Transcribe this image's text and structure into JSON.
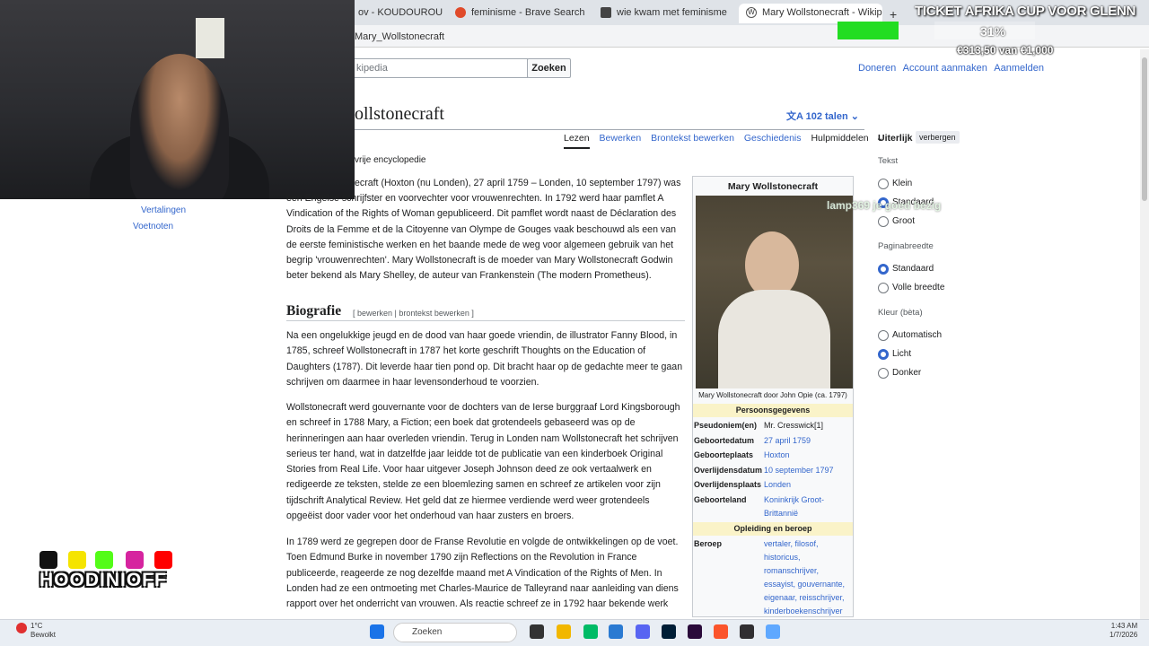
{
  "browser": {
    "tabs": [
      {
        "label": "ov - KOUDOUROU X BOH"
      },
      {
        "label": "feminisme - Brave Search"
      },
      {
        "label": "wie kwam met feminisme"
      },
      {
        "label": "Mary Wollstonecraft - Wikipedia"
      }
    ],
    "new_tab": "+",
    "url": "Mary_Wollstonecraft"
  },
  "wiki": {
    "search_placeholder": "kipedia",
    "search_button": "Zoeken",
    "top_links": [
      "Doneren",
      "Account aanmaken",
      "Aanmelden"
    ],
    "title": "ollstonecraft",
    "languages": "102 talen",
    "tabs": [
      "Lezen",
      "Bewerken",
      "Brontekst bewerken",
      "Geschiedenis",
      "Hulpmiddelen"
    ],
    "tagline": "vrije encyclopedie",
    "toc": [
      "Vertalingen",
      "Voetnoten"
    ],
    "section_heading": "Biografie",
    "section_edit": "[ bewerken | brontekst bewerken ]"
  },
  "infobox": {
    "title": "Mary Wollstonecraft",
    "caption": "Mary Wollstonecraft door John Opie (ca. 1797)",
    "section1": "Persoonsgegevens",
    "section2": "Opleiding en beroep",
    "rows": [
      {
        "k": "Pseudoniem(en)",
        "v": "Mr. Cresswick[1]"
      },
      {
        "k": "Geboortedatum",
        "v": "27 april 1759"
      },
      {
        "k": "Geboorteplaats",
        "v": "Hoxton"
      },
      {
        "k": "Overlijdensdatum",
        "v": "10 september 1797"
      },
      {
        "k": "Overlijdensplaats",
        "v": "Londen"
      },
      {
        "k": "Geboorteland",
        "v": "Koninkrijk Groot-Brittannië"
      }
    ],
    "beroep_label": "Beroep",
    "beroep_value": "vertaler, filosof, historicus, romanschrijver, essayist, gouvernante, eigenaar, reisschrijver, kinderboekenschrijver"
  },
  "appearance": {
    "heading": "Uiterlijk",
    "hide": "verbergen",
    "tekst": "Tekst",
    "tekst_opts": [
      "Klein",
      "Standaard",
      "Groot"
    ],
    "breedte": "Paginabreedte",
    "breedte_opts": [
      "Standaard",
      "Volle breedte"
    ],
    "kleur": "Kleur (bèta)",
    "kleur_opts": [
      "Automatisch",
      "Licht",
      "Donker"
    ]
  },
  "article": {
    "p1_first": "ecraft (Hoxton (nu Londen), 27 april 1759 – Londen, 10 september 1797) was",
    "p1": "een Engelse schrijfster en voorvechter voor vrouwenrechten. In 1792 werd haar pamflet A Vindication of the Rights of Woman gepubliceerd. Dit pamflet wordt naast de Déclaration des Droits de la Femme et de la Citoyenne van Olympe de Gouges vaak beschouwd als een van de eerste feministische werken en het baande mede de weg voor algemeen gebruik van het begrip 'vrouwenrechten'. Mary Wollstonecraft is de moeder van Mary Wollstonecraft Godwin beter bekend als Mary Shelley, de auteur van Frankenstein (The modern Prometheus).",
    "p2": "Na een ongelukkige jeugd en de dood van haar goede vriendin, de illustrator Fanny Blood, in 1785, schreef Wollstonecraft in 1787 het korte geschrift Thoughts on the Education of Daughters (1787). Dit leverde haar tien pond op. Dit bracht haar op de gedachte meer te gaan schrijven om daarmee in haar levensonderhoud te voorzien.",
    "p3": "Wollstonecraft werd gouvernante voor de dochters van de Ierse burggraaf Lord Kingsborough en schreef in 1788 Mary, a Fiction; een boek dat grotendeels gebaseerd was op de herinneringen aan haar overleden vriendin. Terug in Londen nam Wollstonecraft het schrijven serieus ter hand, wat in datzelfde jaar leidde tot de publicatie van een kinderboek Original Stories from Real Life. Voor haar uitgever Joseph Johnson deed ze ook vertaalwerk en redigeerde ze teksten, stelde ze een bloemlezing samen en schreef ze artikelen voor zijn tijdschrift Analytical Review. Het geld dat ze hiermee verdiende werd weer grotendeels opgeëist door vader voor het onderhoud van haar zusters en broers.",
    "p4": "In 1789 werd ze gegrepen door de Franse Revolutie en volgde de ontwikkelingen op de voet. Toen Edmund Burke in november 1790 zijn Reflections on the Revolution in France publiceerde, reageerde ze nog dezelfde maand met A Vindication of the Rights of Men. In Londen had ze een ontmoeting met Charles-Maurice de Talleyrand naar aanleiding van diens rapport over het onderricht van vrouwen. Als reactie schreef ze in 1792 haar bekende werk"
  },
  "overlay": {
    "title": "TICKET AFRIKA CUP VOOR GLENN",
    "progress_percent": 31,
    "progress_label": "31%",
    "money": "€313,50 van €1,000",
    "chat": "lamp369 je goed bezig",
    "brand": "HOODINIOFF"
  },
  "taskbar": {
    "weather_temp": "1°C",
    "weather_desc": "Bewolkt",
    "search": "Zoeken",
    "time": "1:43 AM",
    "date": "1/7/2026"
  },
  "colors": {
    "link": "#3366cc",
    "progress": "#22dd22",
    "infobox_section": "#faf3c8"
  }
}
